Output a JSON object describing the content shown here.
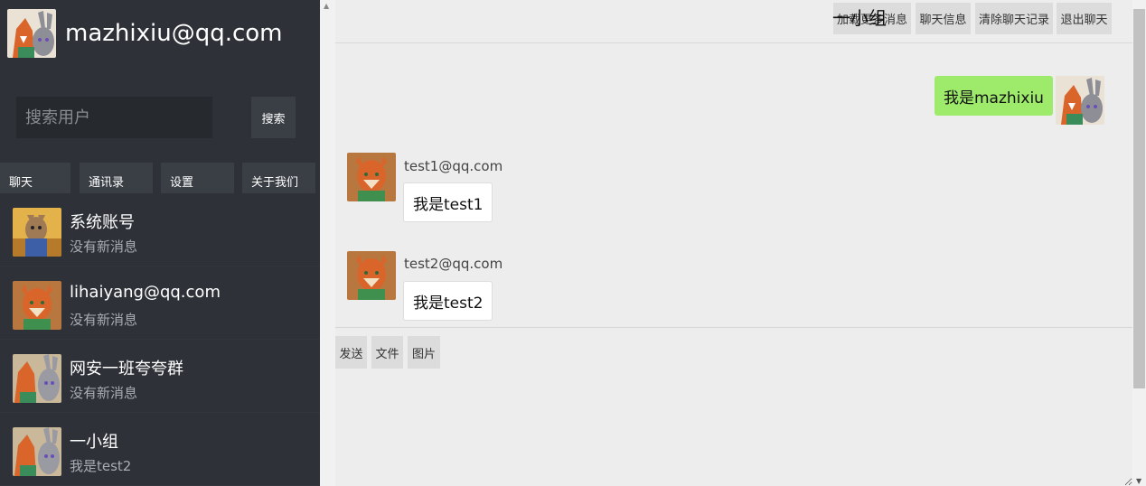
{
  "profile": {
    "email": "mazhixiu@qq.com"
  },
  "search": {
    "placeholder": "搜索用户",
    "button": "搜索"
  },
  "nav": [
    "聊天",
    "通讯录",
    "设置",
    "关于我们"
  ],
  "contacts": [
    {
      "name": "系统账号",
      "last": "没有新消息",
      "avatar": "system-avatar"
    },
    {
      "name": "lihaiyang@qq.com",
      "last": "没有新消息",
      "avatar": "fox-avatar"
    },
    {
      "name": "网安一班夸夸群",
      "last": "没有新消息",
      "avatar": "group-avatar"
    },
    {
      "name": "一小组",
      "last": "我是test2",
      "avatar": "group-avatar"
    }
  ],
  "chat": {
    "title": "一小组",
    "header_buttons": [
      "加载更多消息",
      "聊天信息",
      "清除聊天记录",
      "退出聊天"
    ],
    "messages": [
      {
        "mine": true,
        "text": "我是mazhixiu"
      },
      {
        "mine": false,
        "sender": "test1@qq.com",
        "text": "我是test1"
      },
      {
        "mine": false,
        "sender": "test2@qq.com",
        "text": "我是test2"
      }
    ],
    "tools": [
      "发送",
      "文件",
      "图片"
    ]
  },
  "colors": {
    "sidebar": "#2e3238",
    "my_bubble": "#9eea6a",
    "main_bg": "#ededed"
  }
}
